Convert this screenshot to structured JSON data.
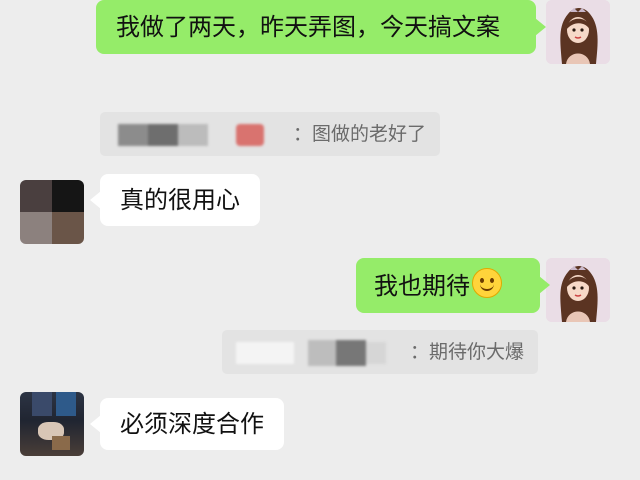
{
  "messages": [
    {
      "from": "self",
      "text": "我做了两天，昨天弄图，今天搞文案"
    },
    {
      "from": "other",
      "text": "真的很用心"
    },
    {
      "from": "self",
      "text": "我也期待",
      "emoji": "smiling-face-icon"
    },
    {
      "from": "other",
      "text": "必须深度合作"
    }
  ],
  "quotes": [
    {
      "text": "：图做的老好了"
    },
    {
      "text": "：期待你大爆"
    }
  ],
  "colors": {
    "background": "#ededed",
    "self_bubble": "#95ec69",
    "other_bubble": "#ffffff",
    "quote_bg": "#e3e3e3"
  }
}
